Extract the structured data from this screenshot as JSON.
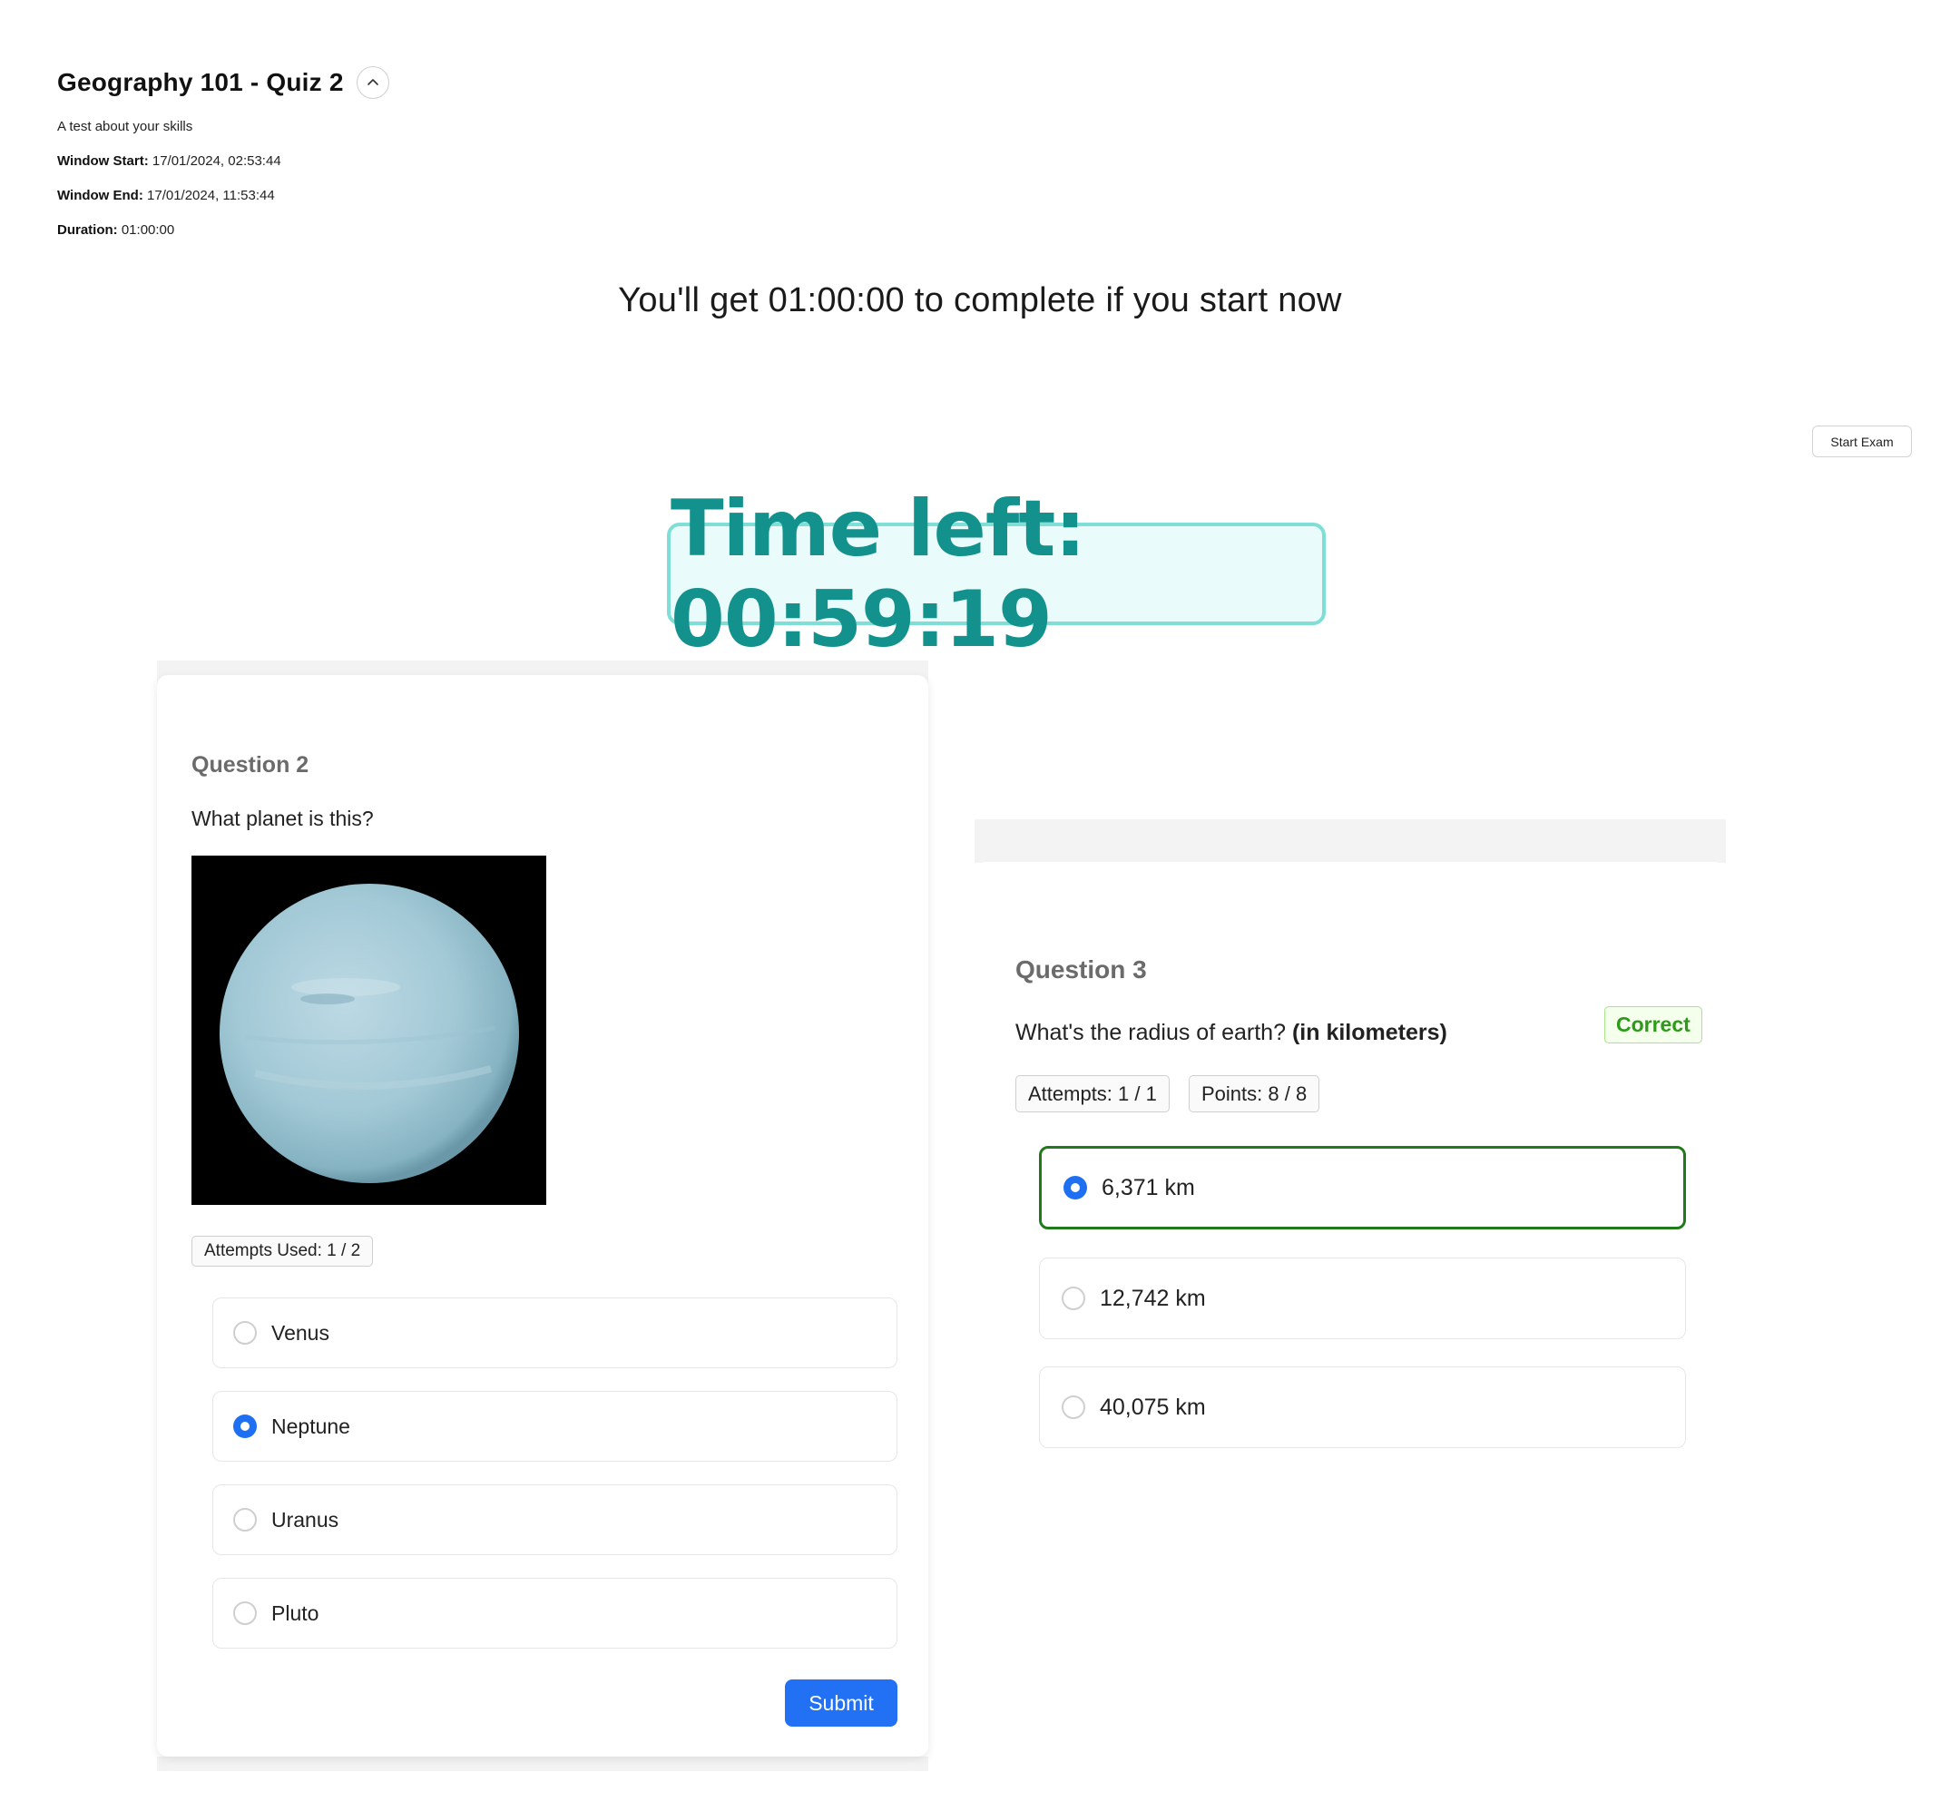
{
  "header": {
    "title": "Geography 101 - Quiz 2",
    "description": "A test about your skills",
    "window_start_label": "Window Start:",
    "window_start_value": "17/01/2024, 02:53:44",
    "window_end_label": "Window End:",
    "window_end_value": "17/01/2024, 11:53:44",
    "duration_label": "Duration:",
    "duration_value": "01:00:00",
    "collapse_icon": "chevron-up-icon"
  },
  "start": {
    "message": "You'll get 01:00:00 to complete if you start now",
    "button_label": "Start Exam"
  },
  "timer": {
    "text": "Time left: 00:59:19",
    "color": "#13918c",
    "background": "#e9fbfa",
    "border": "#7fded5"
  },
  "question2": {
    "heading": "Question 2",
    "text": "What planet is this?",
    "image": "neptune-planet-image",
    "attempts": "Attempts Used: 1 / 2",
    "options": [
      {
        "label": "Venus",
        "selected": false
      },
      {
        "label": "Neptune",
        "selected": true
      },
      {
        "label": "Uranus",
        "selected": false
      },
      {
        "label": "Pluto",
        "selected": false
      }
    ],
    "submit_label": "Submit"
  },
  "question3": {
    "heading": "Question 3",
    "text": "What's the radius of earth?",
    "text_bold": "(in kilometers)",
    "status": "Correct",
    "attempts": "Attempts: 1 / 1",
    "points": "Points: 8 / 8",
    "options": [
      {
        "label": "6,371 km",
        "selected": true,
        "correct": true
      },
      {
        "label": "12,742 km",
        "selected": false
      },
      {
        "label": "40,075 km",
        "selected": false
      }
    ]
  },
  "colors": {
    "accent": "#2271f5",
    "correct": "#2d9a1a",
    "correct_border": "#1f7a1a"
  }
}
